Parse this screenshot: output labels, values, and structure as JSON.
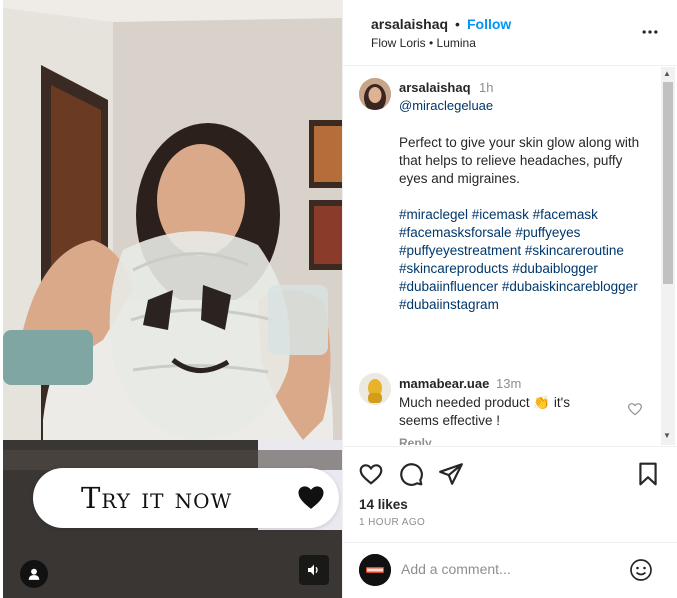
{
  "media": {
    "cta_text": "Try it now",
    "icons": {
      "heart": "heart-icon",
      "user": "user-tag-icon",
      "sound": "speaker-icon"
    }
  },
  "header": {
    "username": "arsalaishaq",
    "separator": "•",
    "follow_label": "Follow",
    "audio": "Flow Loris • Lumina",
    "more_icon": "more-options-icon"
  },
  "caption": {
    "username": "arsalaishaq",
    "time": "1h",
    "mention": "@miraclegeluae",
    "text": "Perfect to give your skin glow along with that helps to relieve headaches, puffy eyes and migraines.",
    "hashtags": [
      "#miraclegel",
      "#icemask",
      "#facemask",
      "#facemasksforsale",
      "#puffyeyes",
      "#puffyeyestreatment",
      "#skincareroutine",
      "#skincareproducts",
      "#dubaiblogger",
      "#dubaiinfluencer",
      "#dubaiskincareblogger",
      "#dubaiinstagram"
    ]
  },
  "comment": {
    "username": "mamabear.uae",
    "time": "13m",
    "text": "Much needed product 👏 it's seems effective !",
    "reply_label": "Reply"
  },
  "actions": {
    "icons": [
      "like-icon",
      "comment-icon",
      "share-icon",
      "save-icon"
    ],
    "likes": "14 likes",
    "posted": "1 HOUR AGO"
  },
  "add_comment": {
    "placeholder": "Add a comment...",
    "emoji_icon": "emoji-icon"
  },
  "colors": {
    "link": "#00376b",
    "follow": "#0095f6",
    "muted": "#8e8e8e",
    "text": "#262626"
  }
}
